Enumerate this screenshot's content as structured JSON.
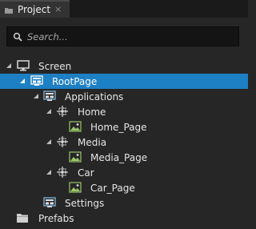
{
  "tab": {
    "title": "Project",
    "close_glyph": "×",
    "icon": "folder-icon"
  },
  "search": {
    "placeholder": "Search...",
    "value": "",
    "icon": "search-icon"
  },
  "colors": {
    "selection": "#1d7fc4",
    "background": "#262626",
    "search_bg": "#141414",
    "tabbar": "#1a1a1a"
  },
  "tree": [
    {
      "label": "Screen",
      "icon": "monitor-icon",
      "expanded": true,
      "selected": false
    },
    {
      "label": "RootPage",
      "icon": "page-icon",
      "expanded": true,
      "selected": true
    },
    {
      "label": "Applications",
      "icon": "page-icon",
      "expanded": true,
      "selected": false
    },
    {
      "label": "Home",
      "icon": "node-icon",
      "expanded": true,
      "selected": false
    },
    {
      "label": "Home_Page",
      "icon": "image-icon",
      "expanded": false,
      "selected": false
    },
    {
      "label": "Media",
      "icon": "node-icon",
      "expanded": true,
      "selected": false
    },
    {
      "label": "Media_Page",
      "icon": "image-icon",
      "expanded": false,
      "selected": false
    },
    {
      "label": "Car",
      "icon": "node-icon",
      "expanded": true,
      "selected": false
    },
    {
      "label": "Car_Page",
      "icon": "image-icon",
      "expanded": false,
      "selected": false
    },
    {
      "label": "Settings",
      "icon": "page-icon",
      "expanded": false,
      "selected": false
    },
    {
      "label": "Prefabs",
      "icon": "folder-icon",
      "expanded": false,
      "selected": false
    }
  ]
}
